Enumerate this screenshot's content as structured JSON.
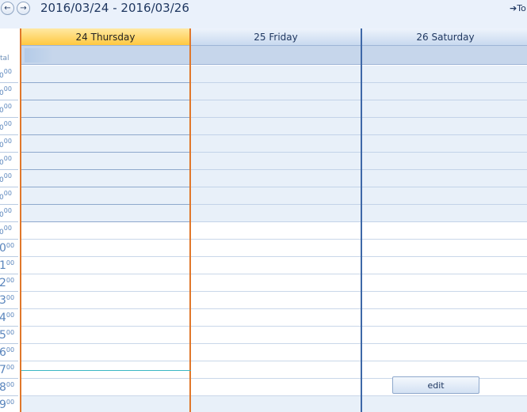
{
  "toolbar": {
    "prev_icon": "prev-arrow-icon",
    "next_icon": "next-arrow-icon",
    "date_range": "2016/03/24 - 2016/03/26",
    "today_label": "To"
  },
  "gutter": {
    "label": "tal",
    "hours": [
      {
        "h": "0",
        "m": "00"
      },
      {
        "h": "0",
        "m": "00"
      },
      {
        "h": "0",
        "m": "00"
      },
      {
        "h": "0",
        "m": "00"
      },
      {
        "h": "0",
        "m": "00"
      },
      {
        "h": "0",
        "m": "00"
      },
      {
        "h": "0",
        "m": "00"
      },
      {
        "h": "0",
        "m": "00"
      },
      {
        "h": "0",
        "m": "00"
      },
      {
        "h": "0",
        "m": "00"
      },
      {
        "h": "0",
        "m": "00"
      },
      {
        "h": "1",
        "m": "00"
      },
      {
        "h": "2",
        "m": "00"
      },
      {
        "h": "3",
        "m": "00"
      },
      {
        "h": "4",
        "m": "00"
      },
      {
        "h": "5",
        "m": "00"
      },
      {
        "h": "6",
        "m": "00"
      },
      {
        "h": "7",
        "m": "00"
      },
      {
        "h": "8",
        "m": "00"
      },
      {
        "h": "9",
        "m": "00"
      }
    ]
  },
  "days": [
    {
      "label": "24 Thursday",
      "today": true
    },
    {
      "label": "25 Friday",
      "today": false
    },
    {
      "label": "26 Saturday",
      "today": false
    }
  ],
  "event": {
    "edit_label": "edit"
  },
  "colors": {
    "today_border": "#e0772a",
    "header_bg": "#c8d9ef",
    "offhours_bg": "#e8f0f9",
    "now_line": "#3bb7c4"
  }
}
